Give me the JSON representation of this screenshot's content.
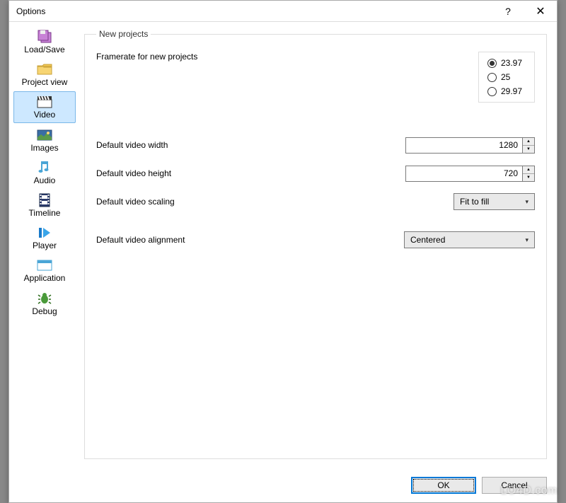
{
  "window": {
    "title": "Options",
    "help_glyph": "?",
    "close_glyph": "✕"
  },
  "sidebar": {
    "items": [
      {
        "id": "load-save",
        "label": "Load/Save",
        "icon": "floppy-icon",
        "selected": false
      },
      {
        "id": "project-view",
        "label": "Project view",
        "icon": "folder-icon",
        "selected": false
      },
      {
        "id": "video",
        "label": "Video",
        "icon": "clapper-icon",
        "selected": true
      },
      {
        "id": "images",
        "label": "Images",
        "icon": "picture-icon",
        "selected": false
      },
      {
        "id": "audio",
        "label": "Audio",
        "icon": "note-icon",
        "selected": false
      },
      {
        "id": "timeline",
        "label": "Timeline",
        "icon": "filmstrip-icon",
        "selected": false
      },
      {
        "id": "player",
        "label": "Player",
        "icon": "play-icon",
        "selected": false
      },
      {
        "id": "application",
        "label": "Application",
        "icon": "window-icon",
        "selected": false
      },
      {
        "id": "debug",
        "label": "Debug",
        "icon": "bug-icon",
        "selected": false
      }
    ]
  },
  "panel": {
    "group_title": "New projects",
    "framerate": {
      "label": "Framerate for new projects",
      "options": [
        "23.97",
        "25",
        "29.97"
      ],
      "selected": "23.97"
    },
    "width": {
      "label": "Default video width",
      "value": "1280"
    },
    "height": {
      "label": "Default video height",
      "value": "720"
    },
    "scaling": {
      "label": "Default video scaling",
      "value": "Fit to fill"
    },
    "alignment": {
      "label": "Default video alignment",
      "value": "Centered"
    }
  },
  "buttons": {
    "ok": "OK",
    "cancel": "Cancel"
  },
  "watermark": "LO4D.com"
}
